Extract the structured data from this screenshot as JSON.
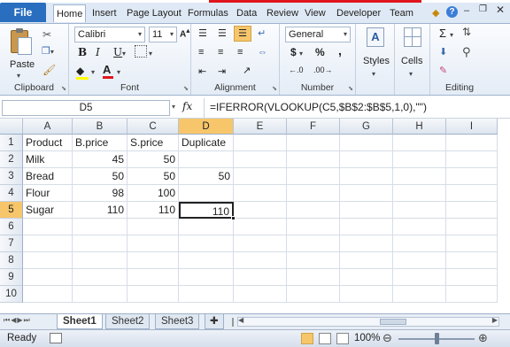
{
  "ribbon_tabs": [
    {
      "label": "File"
    },
    {
      "label": "Home"
    },
    {
      "label": "Insert"
    },
    {
      "label": "Page Layout"
    },
    {
      "label": "Formulas"
    },
    {
      "label": "Data"
    },
    {
      "label": "Review"
    },
    {
      "label": "View"
    },
    {
      "label": "Developer"
    },
    {
      "label": "Team"
    }
  ],
  "groups": {
    "clipboard": {
      "label": "Clipboard",
      "paste_label": "Paste"
    },
    "font": {
      "label": "Font",
      "font_name": "Calibri",
      "font_size": "11",
      "bold": "B",
      "italic": "I",
      "underline": "U"
    },
    "alignment": {
      "label": "Alignment"
    },
    "number": {
      "label": "Number",
      "format": "General",
      "currency": "$",
      "percent": "%",
      "comma": ","
    },
    "styles": {
      "label": "Styles"
    },
    "cells": {
      "label": "Cells"
    },
    "editing": {
      "label": "Editing",
      "sum": "Σ"
    }
  },
  "formula_bar": {
    "name_box": "D5",
    "fx": "fx",
    "formula": "=IFERROR(VLOOKUP(C5,$B$2:$B$5,1,0),\"\")"
  },
  "columns": [
    "A",
    "B",
    "C",
    "D",
    "E",
    "F",
    "G",
    "H",
    "I"
  ],
  "rows": [
    {
      "n": "1",
      "cells": [
        "Product",
        "B.price",
        "S.price",
        "Duplicate",
        "",
        "",
        "",
        "",
        ""
      ]
    },
    {
      "n": "2",
      "cells": [
        "Milk",
        "45",
        "50",
        "",
        "",
        "",
        "",
        "",
        ""
      ]
    },
    {
      "n": "3",
      "cells": [
        "Bread",
        "50",
        "50",
        "50",
        "",
        "",
        "",
        "",
        ""
      ]
    },
    {
      "n": "4",
      "cells": [
        "Flour",
        "98",
        "100",
        "",
        "",
        "",
        "",
        "",
        ""
      ]
    },
    {
      "n": "5",
      "cells": [
        "Sugar",
        "110",
        "110",
        "110",
        "",
        "",
        "",
        "",
        ""
      ]
    },
    {
      "n": "6",
      "cells": [
        "",
        "",
        "",
        "",
        "",
        "",
        "",
        "",
        ""
      ]
    },
    {
      "n": "7",
      "cells": [
        "",
        "",
        "",
        "",
        "",
        "",
        "",
        "",
        ""
      ]
    },
    {
      "n": "8",
      "cells": [
        "",
        "",
        "",
        "",
        "",
        "",
        "",
        "",
        ""
      ]
    },
    {
      "n": "9",
      "cells": [
        "",
        "",
        "",
        "",
        "",
        "",
        "",
        "",
        ""
      ]
    },
    {
      "n": "10",
      "cells": [
        "",
        "",
        "",
        "",
        "",
        "",
        "",
        "",
        ""
      ]
    }
  ],
  "sheets": [
    {
      "label": "Sheet1"
    },
    {
      "label": "Sheet2"
    },
    {
      "label": "Sheet3"
    }
  ],
  "active_sheet": "Sheet1",
  "status": {
    "ready": "Ready",
    "zoom": "100%"
  },
  "accent": {
    "file_tab": "#2a6ebf",
    "selection": "#f7c66b",
    "redbar": "#e0161e"
  }
}
